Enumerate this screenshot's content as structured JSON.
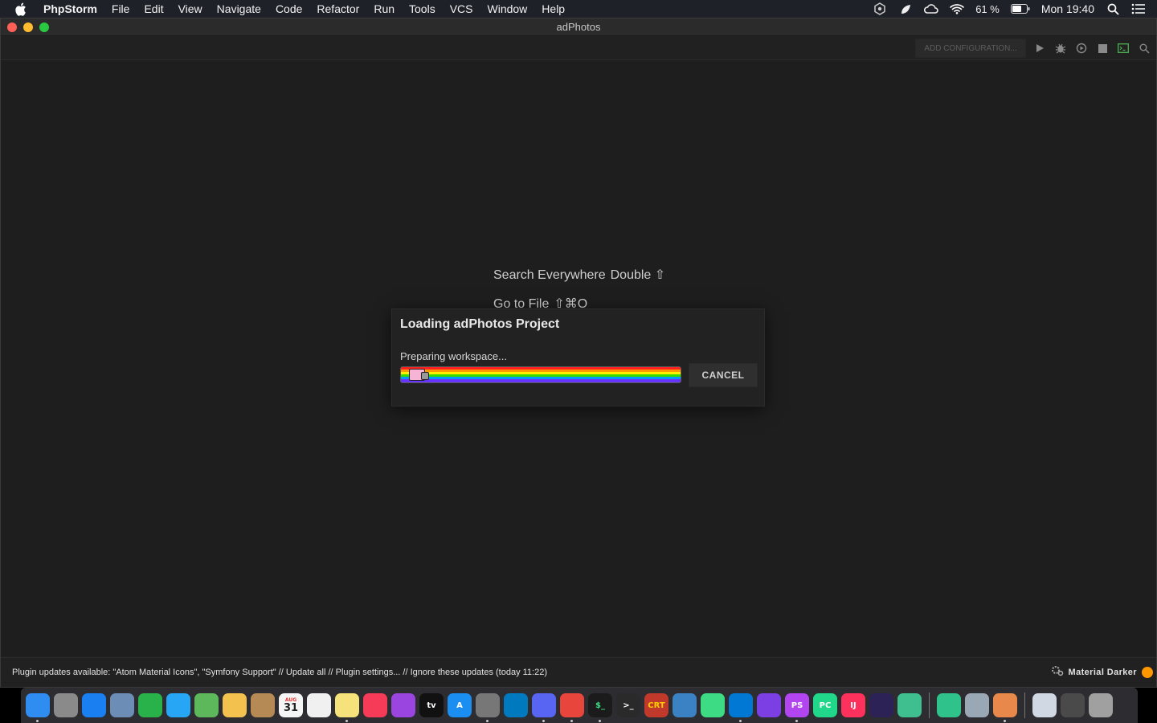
{
  "menubar": {
    "app_name": "PhpStorm",
    "items": [
      "File",
      "Edit",
      "View",
      "Navigate",
      "Code",
      "Refactor",
      "Run",
      "Tools",
      "VCS",
      "Window",
      "Help"
    ],
    "battery": "61 %",
    "clock": "Mon 19:40"
  },
  "window": {
    "title": "adPhotos"
  },
  "toolbar": {
    "add_config_label": "ADD CONFIGURATION..."
  },
  "editor": {
    "hint_search": "Search Everywhere",
    "hint_search_key": "Double ⇧",
    "hint_goto": "Go to File",
    "hint_goto_key": "⇧⌘O"
  },
  "dialog": {
    "title": "Loading adPhotos Project",
    "status": "Preparing workspace...",
    "progress_fraction": 1.0,
    "cancel_label": "CANCEL"
  },
  "statusbar": {
    "message": "Plugin updates available: \"Atom Material Icons\", \"Symfony Support\" // Update all // Plugin settings... // Ignore these updates (today 11:22)",
    "theme_label": "Material Darker",
    "theme_color": "#ff9800"
  },
  "dock": {
    "calendar_day": "31",
    "calendar_month": "AUG",
    "apps": [
      {
        "name": "finder",
        "color": "#2f8cf0",
        "label": "",
        "running": true
      },
      {
        "name": "launchpad",
        "color": "#8a8a8a",
        "label": "",
        "running": false
      },
      {
        "name": "safari",
        "color": "#1a7ff0",
        "label": "",
        "running": false
      },
      {
        "name": "preview",
        "color": "#6c8db5",
        "label": "",
        "running": false
      },
      {
        "name": "facetime",
        "color": "#2ab24a",
        "label": "",
        "running": false
      },
      {
        "name": "messages",
        "color": "#26a6f5",
        "label": "",
        "running": false
      },
      {
        "name": "maps",
        "color": "#5db85b",
        "label": "",
        "running": false
      },
      {
        "name": "photos",
        "color": "#f2c14e",
        "label": "",
        "running": false
      },
      {
        "name": "contacts",
        "color": "#b68a55",
        "label": "",
        "running": false
      },
      {
        "name": "calendar",
        "color": "#f5f5f5",
        "label": "31",
        "running": false
      },
      {
        "name": "reminders",
        "color": "#f0f0f0",
        "label": "",
        "running": false
      },
      {
        "name": "notes",
        "color": "#f5e27a",
        "label": "",
        "running": true
      },
      {
        "name": "music",
        "color": "#f53b57",
        "label": "",
        "running": false
      },
      {
        "name": "podcasts",
        "color": "#9b45e0",
        "label": "",
        "running": false
      },
      {
        "name": "tv",
        "color": "#111111",
        "label": "tv",
        "running": false
      },
      {
        "name": "app-store",
        "color": "#1b8ef2",
        "label": "A",
        "running": false
      },
      {
        "name": "system-preferences",
        "color": "#777777",
        "label": "",
        "running": true
      },
      {
        "name": "trello",
        "color": "#0079bf",
        "label": "",
        "running": false
      },
      {
        "name": "discord",
        "color": "#5865f2",
        "label": "",
        "running": true
      },
      {
        "name": "chrome",
        "color": "#e8453c",
        "label": "",
        "running": true
      },
      {
        "name": "iterm",
        "color": "#1b1b1b",
        "label": "$_",
        "running": true
      },
      {
        "name": "terminal",
        "color": "#2a2a2a",
        "label": ">_",
        "running": false
      },
      {
        "name": "securecrt",
        "color": "#c0392b",
        "label": "CRT",
        "running": false
      },
      {
        "name": "xcode-instruments",
        "color": "#3b82c4",
        "label": "",
        "running": false
      },
      {
        "name": "android-studio",
        "color": "#3ddc84",
        "label": "",
        "running": false
      },
      {
        "name": "vscode",
        "color": "#0078d4",
        "label": "",
        "running": true
      },
      {
        "name": "visual-studio",
        "color": "#7b3fe4",
        "label": "",
        "running": false
      },
      {
        "name": "phpstorm",
        "color": "#b345f1",
        "label": "PS",
        "running": true
      },
      {
        "name": "pycharm",
        "color": "#21d789",
        "label": "PC",
        "running": false
      },
      {
        "name": "intellij",
        "color": "#fe315d",
        "label": "IJ",
        "running": false
      },
      {
        "name": "eclipse",
        "color": "#2c2255",
        "label": "",
        "running": false
      },
      {
        "name": "atom",
        "color": "#3fbf8f",
        "label": "",
        "running": false
      },
      {
        "name": "electron-app",
        "color": "#2fc28a",
        "label": "",
        "running": false
      },
      {
        "name": "image-capture",
        "color": "#9aa7b5",
        "label": "",
        "running": false
      },
      {
        "name": "package-app",
        "color": "#e8884a",
        "label": "",
        "running": true
      },
      {
        "name": "documents-folder",
        "color": "#cfd8e3",
        "label": "",
        "running": false
      },
      {
        "name": "downloads-folder",
        "color": "#4a4a4a",
        "label": "",
        "running": false
      },
      {
        "name": "trash",
        "color": "#a0a0a0",
        "label": "",
        "running": false
      }
    ]
  }
}
